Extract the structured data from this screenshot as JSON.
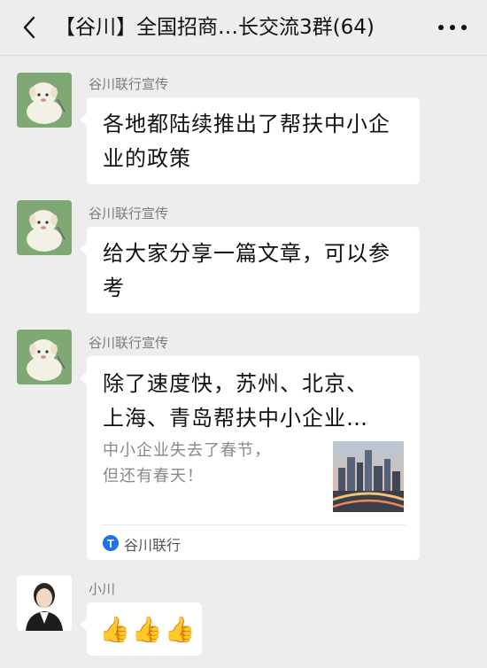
{
  "header": {
    "title": "【谷川】全国招商…长交流3群(64)",
    "back_icon": "chevron-left-icon",
    "more_icon": "ellipsis-icon"
  },
  "messages": [
    {
      "sender": "谷川联行宣传",
      "lines": [
        "各地都陆续推出了帮扶中小企",
        "业的政策"
      ]
    },
    {
      "sender": "谷川联行宣传",
      "lines": [
        "给大家分享一篇文章，可以参",
        "考"
      ]
    },
    {
      "sender": "谷川联行宣传",
      "card": {
        "title_lines": [
          "除了速度快，苏州、北京、",
          "上海、青岛帮扶中小企业…"
        ],
        "desc_lines": [
          "中小企业失去了春节，",
          "但还有春天！"
        ],
        "source": "谷川联行",
        "thumbnail": "city-skyline-image"
      }
    },
    {
      "sender": "小川",
      "emoji": [
        "👍",
        "👍",
        "👍"
      ]
    }
  ]
}
